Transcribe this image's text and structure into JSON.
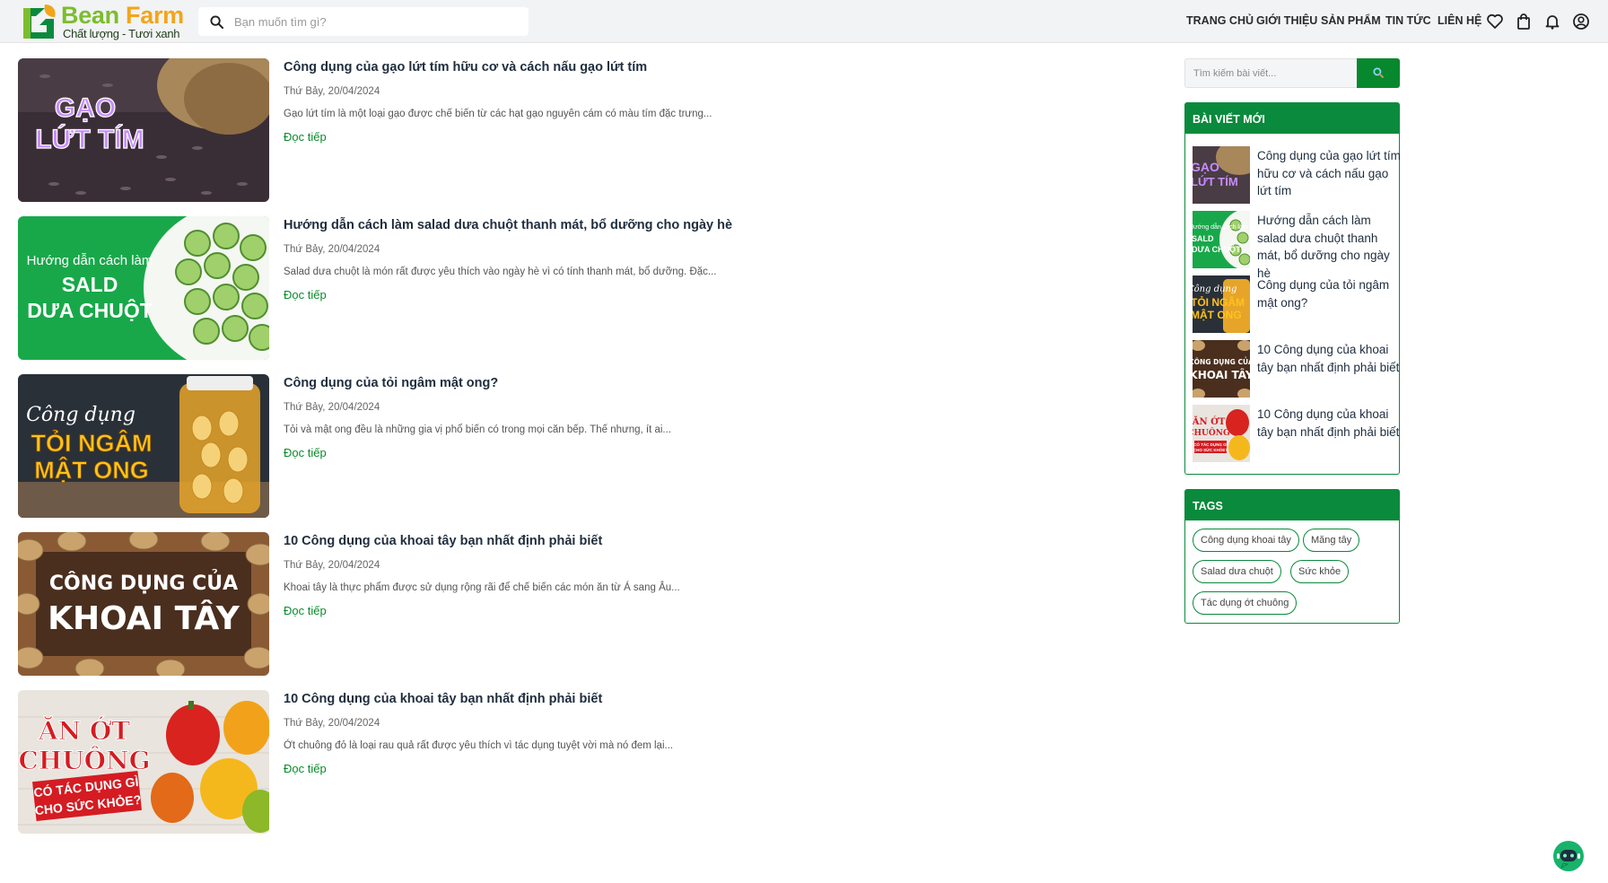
{
  "brand": {
    "name_bean": "Bean",
    "name_farm": "Farm",
    "tagline": "Chất lượng - Tươi xanh"
  },
  "search": {
    "placeholder": "Bạn muốn tìm gì?"
  },
  "nav": {
    "items": [
      "TRANG CHỦ",
      "GIỚI THIỆU",
      "SẢN PHẨM",
      "TIN TỨC",
      "LIÊN HỆ"
    ],
    "icons": [
      "heart-icon",
      "shopping-bag-icon",
      "bell-icon",
      "user-icon"
    ]
  },
  "read_more": "Đọc tiếp",
  "articles": [
    {
      "title": "Công dụng của gạo lứt tím hữu cơ và cách nấu gạo lứt tím",
      "date": "Thứ Bảy, 20/04/2024",
      "excerpt": "Gạo lứt tím là một loại gạo được chế biến từ các hạt gạo nguyên cám có màu tím đặc trưng...",
      "image_text": [
        "GẠO",
        "LỨT TÍM"
      ]
    },
    {
      "title": "Hướng dẫn cách làm salad dưa chuột thanh mát, bổ dưỡng cho ngày hè",
      "date": "Thứ Bảy, 20/04/2024",
      "excerpt": "Salad dưa chuột là món rất được yêu thích vào ngày hè vì có tính thanh mát, bổ dưỡng. Đặc...",
      "image_text": [
        "Hướng dẫn cách làm",
        "SALD",
        "DƯA CHUỘT"
      ]
    },
    {
      "title": "Công dụng của tỏi ngâm mật ong?",
      "date": "Thứ Bảy, 20/04/2024",
      "excerpt": "Tỏi và mật ong đều là những gia vị phổ biến có trong mọi căn bếp. Thế nhưng, ít ai...",
      "image_text": [
        "Công dụng",
        "TỎI NGÂM",
        "MẬT ONG"
      ]
    },
    {
      "title": "10 Công dụng của khoai tây bạn nhất định phải biết",
      "date": "Thứ Bảy, 20/04/2024",
      "excerpt": "Khoai tây là thực phẩm được sử dụng rộng rãi để chế biến các món ăn từ Á sang Âu...",
      "image_text": [
        "CÔNG DỤNG CỦA",
        "KHOAI TÂY"
      ]
    },
    {
      "title": "10 Công dụng của khoai tây bạn nhất định phải biết",
      "date": "Thứ Bảy, 20/04/2024",
      "excerpt": "Ớt chuông đỏ là loại rau quả rất được yêu thích vì tác dụng tuyệt vời mà nó đem lại...",
      "image_text": [
        "ĂN ỚT",
        "CHUÔNG",
        "CÓ TÁC DỤNG GÌ",
        "CHO SỨC KHỎE?"
      ]
    }
  ],
  "sidebar": {
    "search_placeholder": "Tìm kiếm bài viết...",
    "recent_title": "BÀI VIẾT MỚI",
    "recent": [
      "Công dụng của gạo lứt tím hữu cơ và cách nấu gạo lứt tím",
      "Hướng dẫn cách làm salad dưa chuột thanh mát, bổ dưỡng cho ngày hè",
      "Công dụng của tỏi ngâm mật ong?",
      "10 Công dụng của khoai tây bạn nhất định phải biết",
      "10 Công dụng của khoai tây bạn nhất định phải biết"
    ],
    "tags_title": "TAGS",
    "tags": [
      "Công dụng khoai tây",
      "Măng tây",
      "Salad dưa chuột",
      "Sức khỏe",
      "Tác dụng ớt chuông"
    ]
  },
  "colors": {
    "brand_green": "#0a8a3c",
    "logo_green": "#7cbd2e",
    "logo_orange": "#f2a51a",
    "link_green": "#0a8a2c",
    "header_bg": "#f2f3f4"
  }
}
